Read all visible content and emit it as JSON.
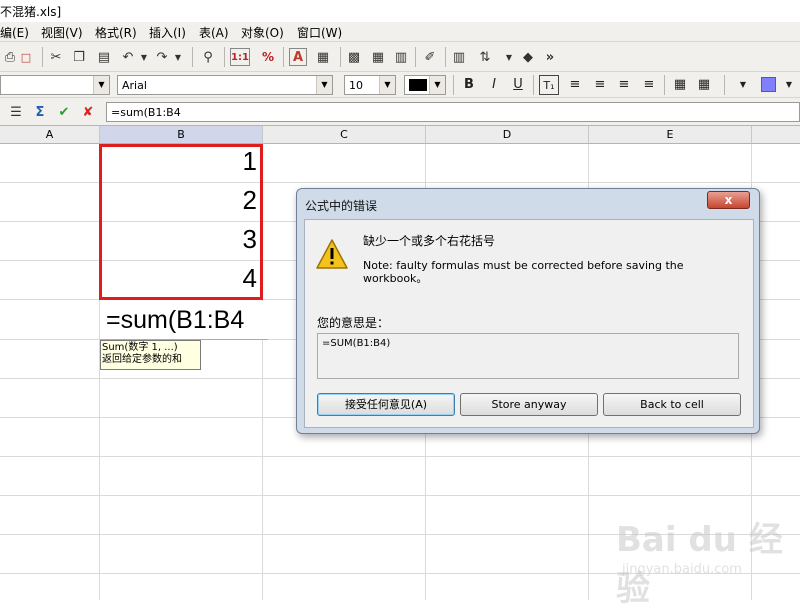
{
  "window": {
    "title": "不混猪.xls]"
  },
  "menu": [
    "编(E)",
    "视图(V)",
    "格式(R)",
    "插入(I)",
    "表(A)",
    "对象(O)",
    "窗口(W)"
  ],
  "toolbar_icons": [
    "print-icon",
    "pdf-icon",
    "cut-icon",
    "copy-icon",
    "paste-icon",
    "undo-icon",
    "redo-icon",
    "find-icon",
    "numbering-icon",
    "percent-icon",
    "text-icon",
    "grid-icon",
    "border-icon",
    "fill-icon",
    "brush-icon",
    "chart-icon",
    "sort-icon",
    "object-icon",
    "more-icon"
  ],
  "format": {
    "style_value": "",
    "font_name": "Arial",
    "font_size": "10",
    "font_color": "#000000",
    "bold": "B",
    "italic": "I",
    "underline": "U",
    "highlight_color": "#8080ff"
  },
  "formula_bar": {
    "value": "=sum(B1:B4"
  },
  "columns": [
    "A",
    "B",
    "C",
    "D",
    "E"
  ],
  "selected_column": "B",
  "cells": {
    "b1": "1",
    "b2": "2",
    "b3": "3",
    "b4": "4",
    "b5": "=sum(B1:B4"
  },
  "tooltip": {
    "line1": "Sum(数字 1, ...)",
    "line2": "返回给定参数的和"
  },
  "dialog": {
    "title": "公式中的错误",
    "close_label": "x",
    "error_message": "缺少一个或多个右花括号",
    "note": "Note: faulty formulas must be corrected before saving the workbook。",
    "suggestion_label": "您的意思是：",
    "suggestion": "=SUM(B1:B4)",
    "buttons": {
      "accept": "接受任何意见(A)",
      "store": "Store anyway",
      "back": "Back to cell"
    }
  },
  "watermark": {
    "brand": "Bai du 经验",
    "url": "jingyan.baidu.com"
  }
}
